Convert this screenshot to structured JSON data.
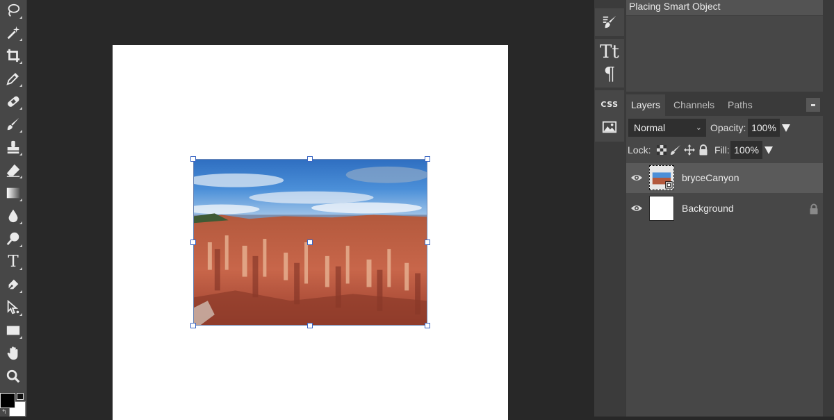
{
  "toolbar": {
    "tools": [
      {
        "icon": "lasso-icon"
      },
      {
        "icon": "magic-wand-icon"
      },
      {
        "icon": "crop-icon"
      },
      {
        "icon": "eyedropper-icon"
      },
      {
        "icon": "healing-brush-icon"
      },
      {
        "icon": "brush-icon"
      },
      {
        "icon": "clone-stamp-icon"
      },
      {
        "icon": "eraser-icon"
      },
      {
        "icon": "gradient-icon"
      },
      {
        "icon": "blur-drop-icon"
      },
      {
        "icon": "dodge-icon"
      },
      {
        "icon": "type-icon",
        "glyph": "T"
      },
      {
        "icon": "pen-icon"
      },
      {
        "icon": "path-select-icon"
      },
      {
        "icon": "rectangle-shape-icon"
      },
      {
        "icon": "hand-icon"
      },
      {
        "icon": "zoom-icon"
      }
    ],
    "foreground_color": "#000000",
    "background_color": "#ffffff"
  },
  "panel_strip": {
    "icons": [
      "history-brush-icon",
      "character-icon",
      "paragraph-icon",
      "css-icon",
      "image-icon"
    ],
    "character_glyph": "Tt",
    "paragraph_glyph": "¶",
    "css_label": "CSS"
  },
  "history": {
    "items": [
      {
        "label": "Placing Smart Object"
      }
    ]
  },
  "layers_panel": {
    "tabs": [
      {
        "label": "Layers",
        "active": true
      },
      {
        "label": "Channels",
        "active": false
      },
      {
        "label": "Paths",
        "active": false
      }
    ],
    "blend_mode": "Normal",
    "opacity_label": "Opacity:",
    "opacity_value": "100%",
    "lock_label": "Lock:",
    "fill_label": "Fill:",
    "fill_value": "100%",
    "layers": [
      {
        "name": "bryceCanyon",
        "visible": true,
        "selected": true,
        "locked": false,
        "thumbnail": "smart-object"
      },
      {
        "name": "Background",
        "visible": true,
        "selected": false,
        "locked": true,
        "thumbnail": "white"
      }
    ]
  },
  "colors": {
    "ui_dark": "#282828",
    "panel": "#474747",
    "selection": "#5a5a5a",
    "handle_border": "#3a66c4"
  }
}
